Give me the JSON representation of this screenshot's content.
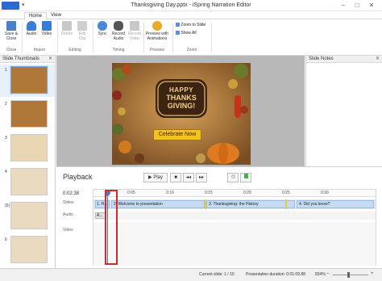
{
  "app": {
    "window_title": "Thanksgiving Day.pptx - iSpring Narration Editor",
    "tabs": [
      "Home",
      "View"
    ]
  },
  "ribbon": {
    "buttons": {
      "save_close": "Save & Close",
      "audio": "Audio",
      "video": "Video",
      "delete": "Delete",
      "edit_clip": "Edit Clip",
      "sync": "Sync",
      "record_audio": "Record Audio",
      "record_video": "Record Video",
      "preview": "Preview with Animations",
      "zoom_to_slide": "Zoom to Slide",
      "show_all": "Show All"
    },
    "groups": {
      "close": "Close",
      "import": "Import",
      "editing": "Editing",
      "timing": "Timing",
      "preview": "Preview",
      "zoom": "Zoom"
    }
  },
  "left_panel": {
    "title": "Slide Thumbnails",
    "thumbs": [
      {
        "num": "1",
        "selected": true
      },
      {
        "num": "2",
        "selected": false
      },
      {
        "num": "3",
        "selected": false
      },
      {
        "num": "4",
        "selected": false
      },
      {
        "num": "(5)",
        "selected": false
      },
      {
        "num": "6",
        "selected": false
      }
    ]
  },
  "slide": {
    "line1": "HAPPY",
    "line2": "THANKS",
    "line3": "GIVING!",
    "button": "Celebrate Now"
  },
  "notes_panel": {
    "title": "Slide Notes"
  },
  "playback": {
    "title": "Playback",
    "play": "Play",
    "time": "0:02.38",
    "ruler": [
      "0:05",
      "0:10",
      "0:15",
      "0:20",
      "0:25",
      "0:30"
    ],
    "track_labels": {
      "slides": "Slides",
      "audio": "Audio",
      "video": "Video"
    },
    "slide_blocks": [
      "1. H...",
      "2. Welcome to presentation",
      "3. Thanksgiving: the History",
      "4. Did you know?"
    ],
    "audio_block": "A..."
  },
  "status": {
    "current_slide": "Current slide: 1 / 10",
    "duration": "Presentation duration: 0:01:09.88",
    "zoom": "834%"
  }
}
